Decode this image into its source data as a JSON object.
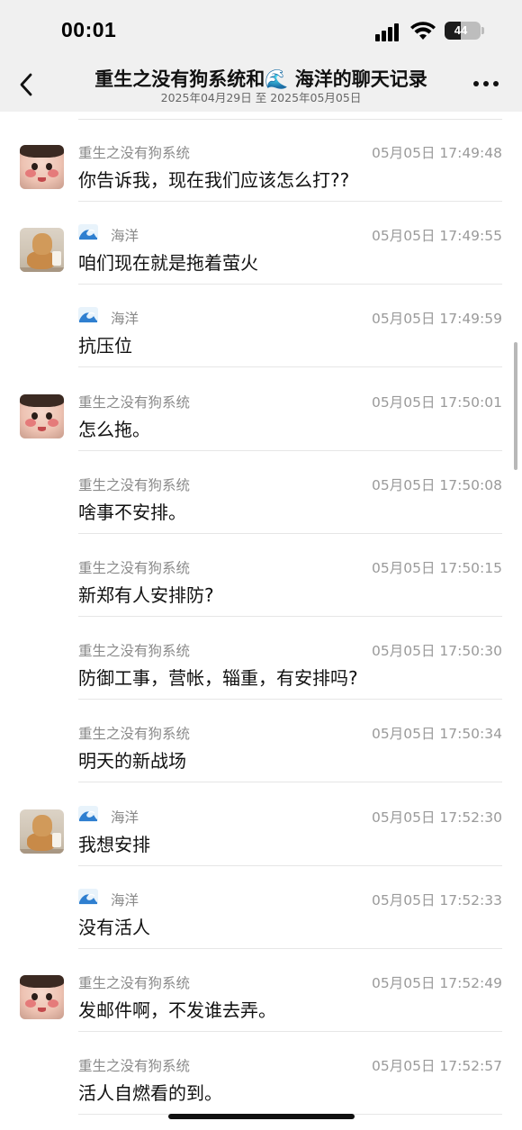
{
  "status": {
    "time": "00:01",
    "battery": "44",
    "battery_level": 0.44
  },
  "header": {
    "title": "重生之没有狗系统和🌊 海洋的聊天记录",
    "date_range": "2025年04月29日 至 2025年05月05日"
  },
  "messages": [
    {
      "sender": "重生之没有狗系统",
      "avatar": "baby-avatar",
      "show_avatar": true,
      "time": "05月05日 17:49:48",
      "text": "你告诉我，现在我们应该怎么打??"
    },
    {
      "sender": "海洋",
      "sender_icon": "wave-emoji-icon",
      "avatar": "dog-avatar",
      "show_avatar": true,
      "time": "05月05日 17:49:55",
      "text": "咱们现在就是拖着萤火"
    },
    {
      "sender": "海洋",
      "sender_icon": "wave-emoji-icon",
      "avatar": "dog-avatar",
      "show_avatar": false,
      "time": "05月05日 17:49:59",
      "text": "抗压位"
    },
    {
      "sender": "重生之没有狗系统",
      "avatar": "baby-avatar",
      "show_avatar": true,
      "time": "05月05日 17:50:01",
      "text": "怎么拖。"
    },
    {
      "sender": "重生之没有狗系统",
      "avatar": "baby-avatar",
      "show_avatar": false,
      "time": "05月05日 17:50:08",
      "text": "啥事不安排。"
    },
    {
      "sender": "重生之没有狗系统",
      "avatar": "baby-avatar",
      "show_avatar": false,
      "time": "05月05日 17:50:15",
      "text": "新郑有人安排防?"
    },
    {
      "sender": "重生之没有狗系统",
      "avatar": "baby-avatar",
      "show_avatar": false,
      "time": "05月05日 17:50:30",
      "text": "防御工事，营帐，辎重，有安排吗?"
    },
    {
      "sender": "重生之没有狗系统",
      "avatar": "baby-avatar",
      "show_avatar": false,
      "time": "05月05日 17:50:34",
      "text": "明天的新战场"
    },
    {
      "sender": "海洋",
      "sender_icon": "wave-emoji-icon",
      "avatar": "dog-avatar",
      "show_avatar": true,
      "time": "05月05日 17:52:30",
      "text": "我想安排"
    },
    {
      "sender": "海洋",
      "sender_icon": "wave-emoji-icon",
      "avatar": "dog-avatar",
      "show_avatar": false,
      "time": "05月05日 17:52:33",
      "text": "没有活人"
    },
    {
      "sender": "重生之没有狗系统",
      "avatar": "baby-avatar",
      "show_avatar": true,
      "time": "05月05日 17:52:49",
      "text": "发邮件啊，不发谁去弄。"
    },
    {
      "sender": "重生之没有狗系统",
      "avatar": "baby-avatar",
      "show_avatar": false,
      "time": "05月05日 17:52:57",
      "text": "活人自燃看的到。"
    }
  ]
}
